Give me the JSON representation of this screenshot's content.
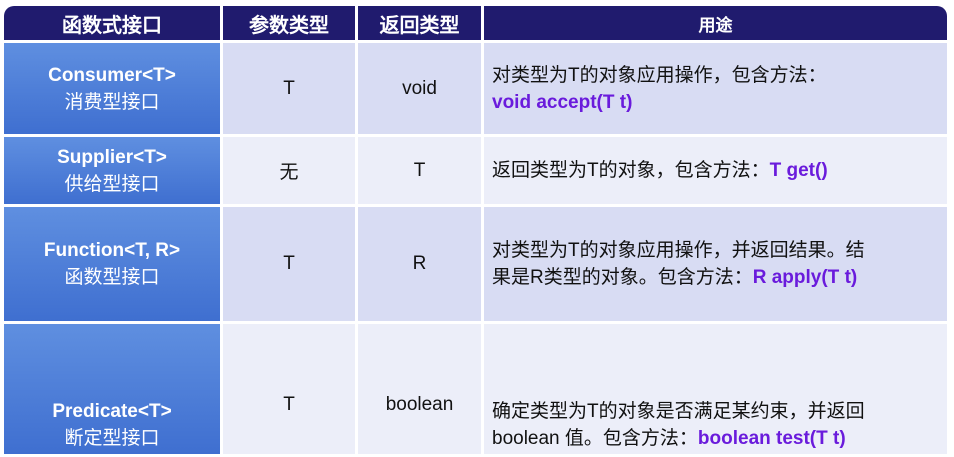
{
  "headers": [
    "函数式接口",
    "参数类型",
    "返回类型",
    "用途"
  ],
  "rows": [
    {
      "name_en": "Consumer<T>",
      "name_cn": "消费型接口",
      "param": "T",
      "ret": "void",
      "desc_lines": [
        "对类型为T的对象应用操作，包含方法："
      ],
      "desc_tail_text": "",
      "desc_code": "void accept(T t)"
    },
    {
      "name_en": "Supplier<T>",
      "name_cn": "供给型接口",
      "param": "无",
      "ret": "T",
      "desc_lines": [],
      "desc_tail_text": "返回类型为T的对象，包含方法：",
      "desc_code": "T get()"
    },
    {
      "name_en": "Function<T, R>",
      "name_cn": "函数型接口",
      "param": "T",
      "ret": "R",
      "desc_lines": [
        "对类型为T的对象应用操作，并返回结果。结"
      ],
      "desc_tail_text": "果是R类型的对象。包含方法：",
      "desc_code": "R apply(T t)"
    },
    {
      "name_en": "Predicate<T>",
      "name_cn": "断定型接口",
      "param": "T",
      "ret": "boolean",
      "desc_lines": [
        "确定类型为T的对象是否满足某约束，并返回"
      ],
      "desc_tail_text": "boolean 值。包含方法：",
      "desc_code": "boolean test(T t)"
    }
  ],
  "colors": {
    "header_bg": "#201b6e",
    "name_cell_bg": "#4f7fd8",
    "row_odd_bg": "#d8dcf3",
    "row_even_bg": "#eceef9",
    "code_text": "#6a1bdc"
  }
}
